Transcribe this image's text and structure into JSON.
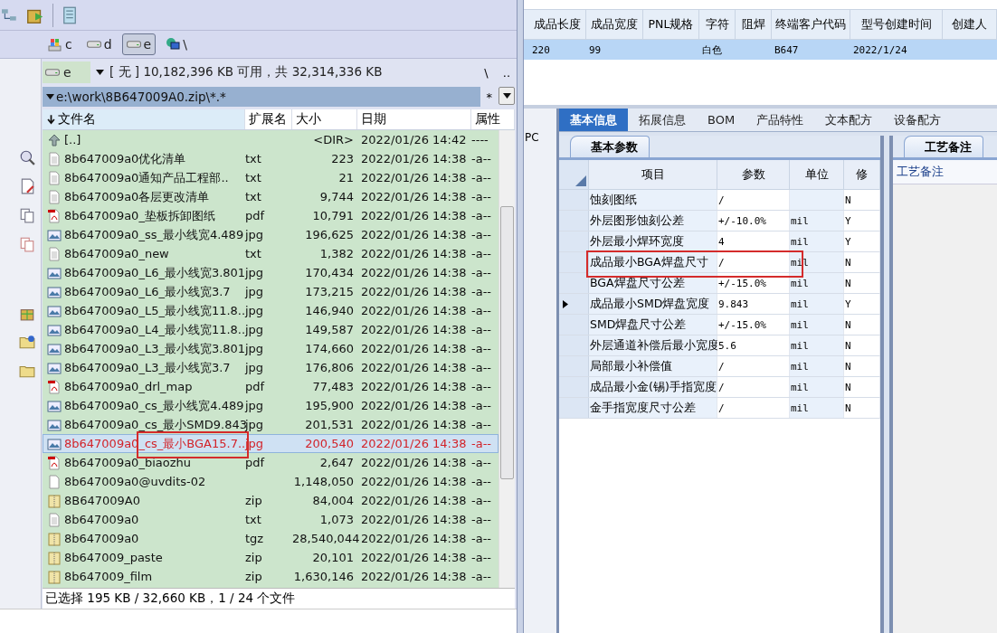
{
  "file_manager": {
    "drives": [
      {
        "label": "c",
        "kind": "system",
        "selected": false
      },
      {
        "label": "d",
        "kind": "disk",
        "selected": false
      },
      {
        "label": "e",
        "kind": "disk",
        "selected": true
      },
      {
        "label": "\\",
        "kind": "network",
        "selected": false
      }
    ],
    "drive_select": {
      "value": "e"
    },
    "drive_info": "[ 无 ]  10,182,396 KB 可用，共 32,314,336 KB",
    "nav_buttons": [
      "\\",
      ".."
    ],
    "path": "e:\\work\\8B647009A0.zip\\*.*",
    "filter": "*",
    "columns": [
      "文件名",
      "扩展名",
      "大小",
      "日期",
      "属性"
    ],
    "files": [
      {
        "kind": "up",
        "name": "[..]",
        "size": "<DIR>",
        "date": "2022/01/26 14:42",
        "attr": "----",
        "selected": false,
        "annotated": false
      },
      {
        "kind": "text",
        "name": "8b647009a0优化清单",
        "ext": "txt",
        "size": "223",
        "date": "2022/01/26 14:38",
        "attr": "-a--",
        "selected": false,
        "annotated": false
      },
      {
        "kind": "text",
        "name": "8b647009a0通知产品工程部..",
        "ext": "txt",
        "size": "21",
        "date": "2022/01/26 14:38",
        "attr": "-a--",
        "selected": false,
        "annotated": false
      },
      {
        "kind": "text",
        "name": "8b647009a0各层更改清单",
        "ext": "txt",
        "size": "9,744",
        "date": "2022/01/26 14:38",
        "attr": "-a--",
        "selected": false,
        "annotated": false
      },
      {
        "kind": "pdf",
        "name": "8b647009a0_垫板拆卸图纸",
        "ext": "pdf",
        "size": "10,791",
        "date": "2022/01/26 14:38",
        "attr": "-a--",
        "selected": false,
        "annotated": false
      },
      {
        "kind": "image",
        "name": "8b647009a0_ss_最小线宽4.489",
        "ext": "jpg",
        "size": "196,625",
        "date": "2022/01/26 14:38",
        "attr": "-a--",
        "selected": false,
        "annotated": false
      },
      {
        "kind": "text",
        "name": "8b647009a0_new",
        "ext": "txt",
        "size": "1,382",
        "date": "2022/01/26 14:38",
        "attr": "-a--",
        "selected": false,
        "annotated": false
      },
      {
        "kind": "image",
        "name": "8b647009a0_L6_最小线宽3.801",
        "ext": "jpg",
        "size": "170,434",
        "date": "2022/01/26 14:38",
        "attr": "-a--",
        "selected": false,
        "annotated": false
      },
      {
        "kind": "image",
        "name": "8b647009a0_L6_最小线宽3.7",
        "ext": "jpg",
        "size": "173,215",
        "date": "2022/01/26 14:38",
        "attr": "-a--",
        "selected": false,
        "annotated": false
      },
      {
        "kind": "image",
        "name": "8b647009a0_L5_最小线宽11.8..",
        "ext": "jpg",
        "size": "146,940",
        "date": "2022/01/26 14:38",
        "attr": "-a--",
        "selected": false,
        "annotated": false
      },
      {
        "kind": "image",
        "name": "8b647009a0_L4_最小线宽11.8..",
        "ext": "jpg",
        "size": "149,587",
        "date": "2022/01/26 14:38",
        "attr": "-a--",
        "selected": false,
        "annotated": false
      },
      {
        "kind": "image",
        "name": "8b647009a0_L3_最小线宽3.801",
        "ext": "jpg",
        "size": "174,660",
        "date": "2022/01/26 14:38",
        "attr": "-a--",
        "selected": false,
        "annotated": false
      },
      {
        "kind": "image",
        "name": "8b647009a0_L3_最小线宽3.7",
        "ext": "jpg",
        "size": "176,806",
        "date": "2022/01/26 14:38",
        "attr": "-a--",
        "selected": false,
        "annotated": false
      },
      {
        "kind": "pdf",
        "name": "8b647009a0_drl_map",
        "ext": "pdf",
        "size": "77,483",
        "date": "2022/01/26 14:38",
        "attr": "-a--",
        "selected": false,
        "annotated": false
      },
      {
        "kind": "image",
        "name": "8b647009a0_cs_最小线宽4.489",
        "ext": "jpg",
        "size": "195,900",
        "date": "2022/01/26 14:38",
        "attr": "-a--",
        "selected": false,
        "annotated": false
      },
      {
        "kind": "image",
        "name": "8b647009a0_cs_最小SMD9.843",
        "ext": "jpg",
        "size": "201,531",
        "date": "2022/01/26 14:38",
        "attr": "-a--",
        "selected": false,
        "annotated": false
      },
      {
        "kind": "image",
        "name": "8b647009a0_cs_最小BGA15.7..",
        "ext": "jpg",
        "size": "200,540",
        "date": "2022/01/26 14:38",
        "attr": "-a--",
        "selected": true,
        "annotated": true
      },
      {
        "kind": "pdf",
        "name": "8b647009a0_biaozhu",
        "ext": "pdf",
        "size": "2,647",
        "date": "2022/01/26 14:38",
        "attr": "-a--",
        "selected": false,
        "annotated": false
      },
      {
        "kind": "blank",
        "name": "8b647009a0@uvdits-02",
        "size": "1,148,050",
        "date": "2022/01/26 14:38",
        "attr": "-a--",
        "selected": false,
        "annotated": false
      },
      {
        "kind": "archive",
        "name": "8B647009A0",
        "ext": "zip",
        "size": "84,004",
        "date": "2022/01/26 14:38",
        "attr": "-a--",
        "selected": false,
        "annotated": false
      },
      {
        "kind": "text",
        "name": "8b647009a0",
        "ext": "txt",
        "size": "1,073",
        "date": "2022/01/26 14:38",
        "attr": "-a--",
        "selected": false,
        "annotated": false
      },
      {
        "kind": "archive",
        "name": "8b647009a0",
        "ext": "tgz",
        "size": "28,540,044",
        "date": "2022/01/26 14:38",
        "attr": "-a--",
        "selected": false,
        "annotated": false
      },
      {
        "kind": "archive",
        "name": "8b647009_paste",
        "ext": "zip",
        "size": "20,101",
        "date": "2022/01/26 14:38",
        "attr": "-a--",
        "selected": false,
        "annotated": false
      },
      {
        "kind": "archive",
        "name": "8b647009_film",
        "ext": "zip",
        "size": "1,630,146",
        "date": "2022/01/26 14:38",
        "attr": "-a--",
        "selected": false,
        "annotated": false
      }
    ],
    "status": "已选择 195 KB / 32,660 KB，1 / 24 个文件"
  },
  "product_grid": {
    "columns": [
      "成品长度",
      "成品宽度",
      "PNL规格",
      "字符",
      "阻焊",
      "终端客户代码",
      "型号创建时间",
      "创建人"
    ],
    "rows": [
      {
        "cells": [
          "220",
          "99",
          null,
          "白色",
          null,
          "B647",
          "2022/1/24",
          null
        ],
        "selected": true
      }
    ]
  },
  "side_strip": {
    "label": "PC"
  },
  "tabs": [
    {
      "label": "基本信息",
      "selected": true
    },
    {
      "label": "拓展信息",
      "selected": false
    },
    {
      "label": "BOM",
      "selected": false
    },
    {
      "label": "产品特性",
      "selected": false
    },
    {
      "label": "文本配方",
      "selected": false
    },
    {
      "label": "设备配方",
      "selected": false
    }
  ],
  "params_panel": {
    "tab": "基本参数",
    "columns": [
      "项目",
      "参数",
      "单位",
      "修"
    ],
    "rows": [
      {
        "cells": [
          "蚀刻图纸",
          "/",
          null,
          "N"
        ],
        "current": false,
        "annotated": false
      },
      {
        "cells": [
          "外层图形蚀刻公差",
          "+/-10.0%",
          "mil",
          "Y"
        ],
        "current": false,
        "annotated": false
      },
      {
        "cells": [
          "外层最小焊环宽度",
          "4",
          "mil",
          "Y"
        ],
        "current": false,
        "annotated": false
      },
      {
        "cells": [
          "成品最小BGA焊盘尺寸",
          "/",
          "mil",
          "N"
        ],
        "current": false,
        "annotated": true
      },
      {
        "cells": [
          "BGA焊盘尺寸公差",
          "+/-15.0%",
          "mil",
          "N"
        ],
        "current": false,
        "annotated": false
      },
      {
        "cells": [
          "成品最小SMD焊盘宽度",
          "9.843",
          "mil",
          "Y"
        ],
        "current": true,
        "annotated": false
      },
      {
        "cells": [
          "SMD焊盘尺寸公差",
          "+/-15.0%",
          "mil",
          "N"
        ],
        "current": false,
        "annotated": false
      },
      {
        "cells": [
          "外层通道补偿后最小宽度",
          "5.6",
          "mil",
          "N"
        ],
        "current": false,
        "annotated": false
      },
      {
        "cells": [
          "局部最小补偿值",
          "/",
          "mil",
          "N"
        ],
        "current": false,
        "annotated": false
      },
      {
        "cells": [
          "成品最小金(锡)手指宽度",
          "/",
          "mil",
          "N"
        ],
        "current": false,
        "annotated": false
      },
      {
        "cells": [
          "金手指宽度尺寸公差",
          "/",
          "mil",
          "N"
        ],
        "current": false,
        "annotated": false
      }
    ]
  },
  "notes_panel": {
    "tab": "工艺备注",
    "label": "工艺备注"
  }
}
